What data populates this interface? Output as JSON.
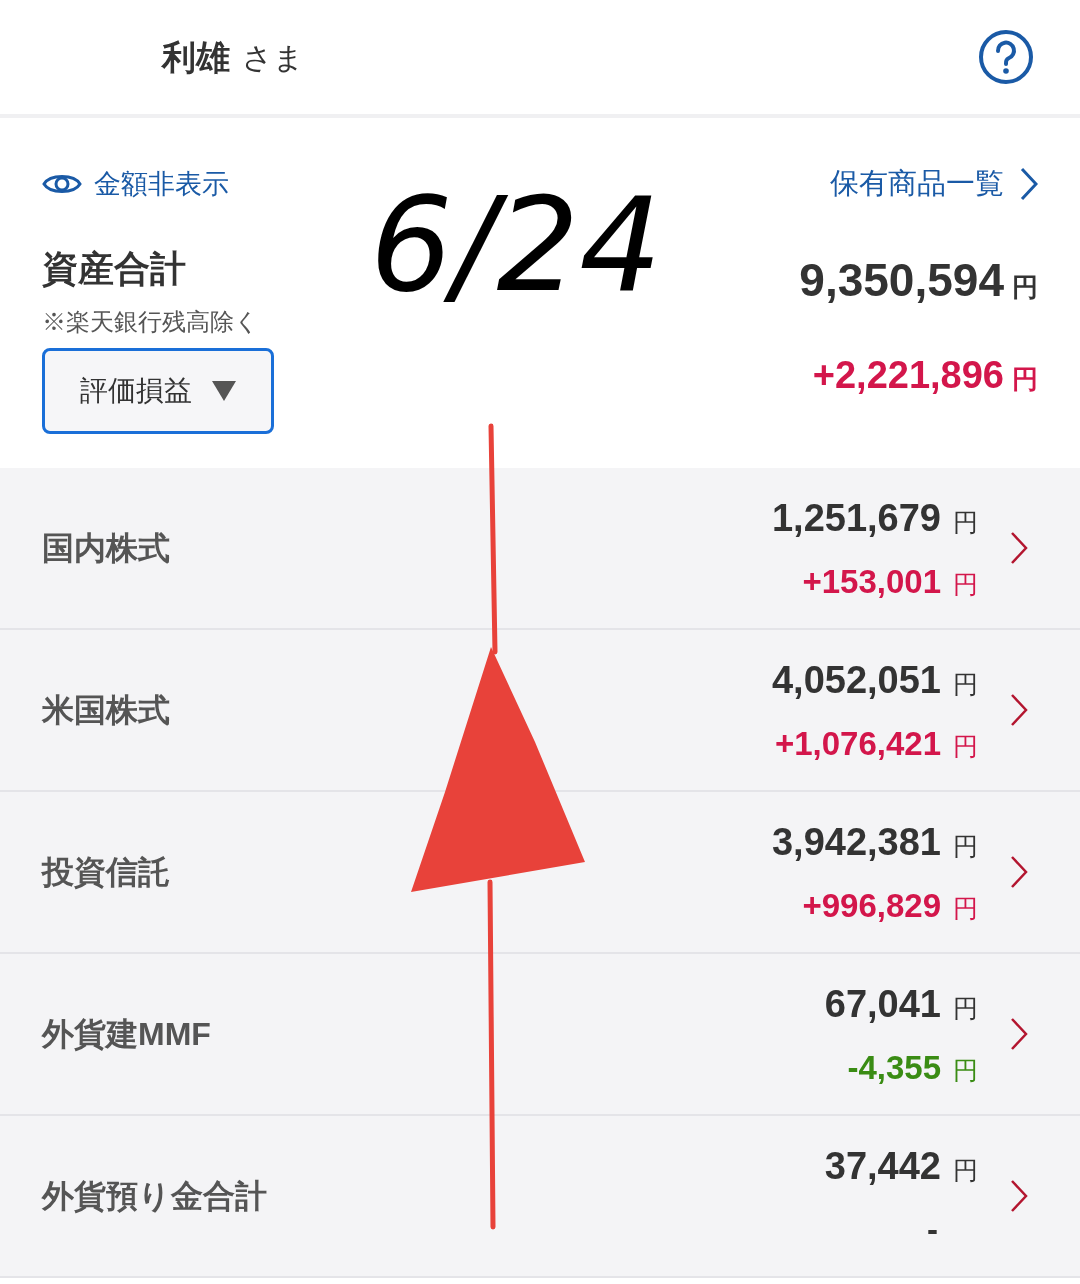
{
  "header": {
    "user_name": "利雄",
    "honorific": "さま"
  },
  "summary": {
    "hide_amounts": "金額非表示",
    "holdings_link": "保有商品一覧",
    "title": "資産合計",
    "note": "※楽天銀行残高除く",
    "total": "9,350,594",
    "total_unit": "円",
    "dropdown": "評価損益",
    "gain": "+2,221,896",
    "gain_unit": "円"
  },
  "annotation": {
    "text": "6/24"
  },
  "categories": [
    {
      "name": "国内株式",
      "value": "1,251,679",
      "unit": "円",
      "change": "+153,001",
      "change_unit": "円",
      "color": "#d3164b"
    },
    {
      "name": "米国株式",
      "value": "4,052,051",
      "unit": "円",
      "change": "+1,076,421",
      "change_unit": "円",
      "color": "#d3164b"
    },
    {
      "name": "投資信託",
      "value": "3,942,381",
      "unit": "円",
      "change": "+996,829",
      "change_unit": "円",
      "color": "#d3164b"
    },
    {
      "name": "外貨建MMF",
      "value": "67,041",
      "unit": "円",
      "change": "-4,355",
      "change_unit": "円",
      "color": "#3a8c14"
    },
    {
      "name": "外貨預り金合計",
      "value": "37,442",
      "unit": "円",
      "change": "-",
      "color": "#333333"
    }
  ]
}
